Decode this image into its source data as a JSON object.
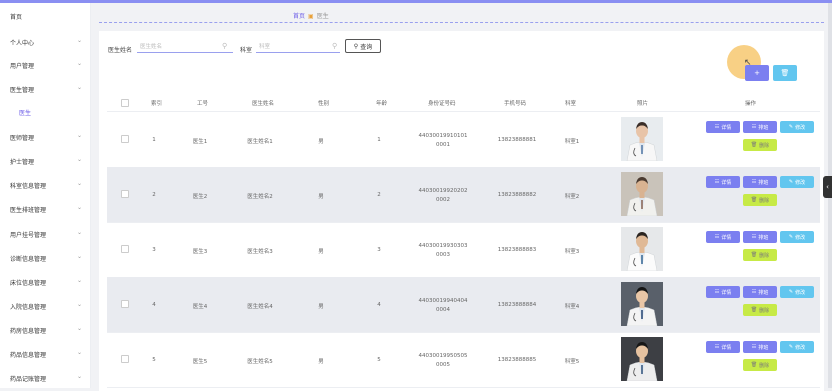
{
  "sidebar": {
    "items": [
      {
        "label": "首页",
        "chevron": false
      },
      {
        "label": "个人中心",
        "chevron": true
      },
      {
        "label": "用户管理",
        "chevron": true
      },
      {
        "label": "医生管理",
        "chevron": true
      },
      {
        "label": "医生",
        "chevron": false,
        "sub": true
      },
      {
        "label": "医师管理",
        "chevron": true
      },
      {
        "label": "护士管理",
        "chevron": true
      },
      {
        "label": "科室信息管理",
        "chevron": true
      },
      {
        "label": "医生排班管理",
        "chevron": true
      },
      {
        "label": "用户挂号管理",
        "chevron": true
      },
      {
        "label": "诊断信息管理",
        "chevron": true
      },
      {
        "label": "床位信息管理",
        "chevron": true
      },
      {
        "label": "入院信息管理",
        "chevron": true
      },
      {
        "label": "药房信息管理",
        "chevron": true
      },
      {
        "label": "药品信息管理",
        "chevron": true
      },
      {
        "label": "药品记账管理",
        "chevron": true
      }
    ]
  },
  "breadcrumb": {
    "home": "首页",
    "current": "医生"
  },
  "search": {
    "name_label": "医生姓名",
    "name_placeholder": "医生姓名",
    "dept_label": "科室",
    "dept_placeholder": "科室",
    "query_label": "查询"
  },
  "toolbar": {
    "add_icon": "plus-icon",
    "delete_icon": "trash-icon"
  },
  "table": {
    "headers": [
      "索引",
      "工号",
      "医生姓名",
      "性别",
      "年龄",
      "身份证号码",
      "手机号码",
      "科室",
      "照片",
      "操作"
    ],
    "rows": [
      {
        "index": "1",
        "id": "医生1",
        "name": "医生姓名1",
        "gender": "男",
        "age": "1",
        "idcard1": "44030019910101",
        "idcard2": "0001",
        "phone": "13823888881",
        "dept": "科室1"
      },
      {
        "index": "2",
        "id": "医生2",
        "name": "医生姓名2",
        "gender": "男",
        "age": "2",
        "idcard1": "44030019920202",
        "idcard2": "0002",
        "phone": "13823888882",
        "dept": "科室2"
      },
      {
        "index": "3",
        "id": "医生3",
        "name": "医生姓名3",
        "gender": "男",
        "age": "3",
        "idcard1": "44030019930303",
        "idcard2": "0003",
        "phone": "13823888883",
        "dept": "科室3"
      },
      {
        "index": "4",
        "id": "医生4",
        "name": "医生姓名4",
        "gender": "男",
        "age": "4",
        "idcard1": "44030019940404",
        "idcard2": "0004",
        "phone": "13823888884",
        "dept": "科室4"
      },
      {
        "index": "5",
        "id": "医生5",
        "name": "医生姓名5",
        "gender": "男",
        "age": "5",
        "idcard1": "44030019950505",
        "idcard2": "0005",
        "phone": "13823888885",
        "dept": "科室5"
      }
    ],
    "actions": {
      "detail": "详情",
      "schedule": "排班",
      "edit": "修改",
      "delete": "删除"
    }
  },
  "colors": {
    "primary": "#7b7ff0",
    "info": "#62c6ef",
    "danger": "#c7ea46",
    "accent": "#8a8ff2"
  }
}
